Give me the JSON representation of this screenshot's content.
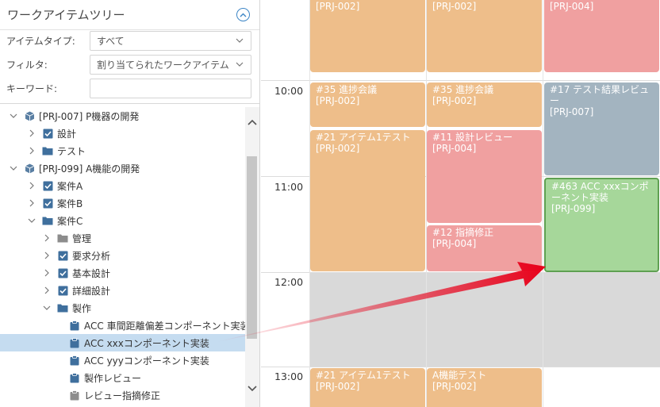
{
  "left_panel": {
    "title": "ワークアイテムツリー",
    "item_type_label": "アイテムタイプ:",
    "item_type_value": "すべて",
    "filter_label": "フィルタ:",
    "filter_value": "割り当てられたワークアイテム",
    "keyword_label": "キーワード:",
    "keyword_value": ""
  },
  "tree": [
    {
      "label": "[PRJ-007] P機器の開発",
      "icon": "cube-icon",
      "level": 0,
      "toggle": "expanded"
    },
    {
      "label": "設計",
      "icon": "checkbox-icon",
      "level": 1,
      "toggle": "collapsed"
    },
    {
      "label": "テスト",
      "icon": "folder-icon",
      "level": 1,
      "toggle": "collapsed"
    },
    {
      "label": "[PRJ-099] A機能の開発",
      "icon": "cube-icon",
      "level": 0,
      "toggle": "expanded"
    },
    {
      "label": "案件A",
      "icon": "checkbox-icon",
      "level": 1,
      "toggle": "collapsed"
    },
    {
      "label": "案件B",
      "icon": "checkbox-icon",
      "level": 1,
      "toggle": "collapsed"
    },
    {
      "label": "案件C",
      "icon": "folder-icon",
      "level": 1,
      "toggle": "expanded"
    },
    {
      "label": "管理",
      "icon": "folder-grey-icon",
      "level": 2,
      "toggle": "collapsed"
    },
    {
      "label": "要求分析",
      "icon": "checkbox-icon",
      "level": 2,
      "toggle": "collapsed"
    },
    {
      "label": "基本設計",
      "icon": "checkbox-icon",
      "level": 2,
      "toggle": "collapsed"
    },
    {
      "label": "詳細設計",
      "icon": "checkbox-icon",
      "level": 2,
      "toggle": "collapsed"
    },
    {
      "label": "製作",
      "icon": "folder-icon",
      "level": 2,
      "toggle": "expanded"
    },
    {
      "label": "ACC 車間距離偏差コンポーネント実装",
      "icon": "clipboard-icon",
      "level": 3,
      "toggle": "none"
    },
    {
      "label": "ACC xxxコンポーネント実装",
      "icon": "clipboard-icon",
      "level": 3,
      "toggle": "none",
      "selected": true
    },
    {
      "label": "ACC yyyコンポーネント実装",
      "icon": "clipboard-icon",
      "level": 3,
      "toggle": "none"
    },
    {
      "label": "製作レビュー",
      "icon": "clipboard-icon",
      "level": 3,
      "toggle": "none"
    },
    {
      "label": "レビュー指摘修正",
      "icon": "clipboard-grey-icon",
      "level": 3,
      "toggle": "none"
    }
  ],
  "calendar": {
    "times": [
      "10:00",
      "11:00",
      "12:00",
      "13:00"
    ],
    "events": [
      {
        "id": "ev-c1-top",
        "title": "",
        "project": "[PRJ-002]",
        "color": "orange"
      },
      {
        "id": "ev-c2-top",
        "title": "",
        "project": "[PRJ-002]",
        "color": "orange"
      },
      {
        "id": "ev-c3-top",
        "title": "",
        "project": "[PRJ-004]",
        "color": "red"
      },
      {
        "id": "ev-c1-35",
        "title": "#35 進捗会議",
        "project": "[PRJ-002]",
        "color": "orange"
      },
      {
        "id": "ev-c2-35",
        "title": "#35 進捗会議",
        "project": "[PRJ-002]",
        "color": "orange"
      },
      {
        "id": "ev-c3-17",
        "title": "#17 テスト結果レビュー",
        "project": "[PRJ-007]",
        "color": "blue"
      },
      {
        "id": "ev-c1-21",
        "title": "#21 アイテム1テスト",
        "project": "[PRJ-002]",
        "color": "orange"
      },
      {
        "id": "ev-c2-11",
        "title": "#11 設計レビュー",
        "project": "[PRJ-004]",
        "color": "red"
      },
      {
        "id": "ev-c3-463",
        "title": "#463 ACC xxxコンポーネント実装",
        "project": "[PRJ-099]",
        "color": "green"
      },
      {
        "id": "ev-c2-12",
        "title": "#12 指摘修正",
        "project": "[PRJ-004]",
        "color": "red"
      },
      {
        "id": "ev-c1-21b",
        "title": "#21 アイテム1テスト",
        "project": "[PRJ-002]",
        "color": "orange"
      },
      {
        "id": "ev-c2-a",
        "title": "A機能テスト",
        "project": "[PRJ-002]",
        "color": "orange"
      }
    ]
  },
  "colors": {
    "accent": "#3d86c6",
    "event_orange": "#eebe8a",
    "event_red": "#f0a0a0",
    "event_blue": "#a3b4c0",
    "event_green": "#a6d79a",
    "selection": "#c5dcf0",
    "arrow": "#e8001a"
  }
}
